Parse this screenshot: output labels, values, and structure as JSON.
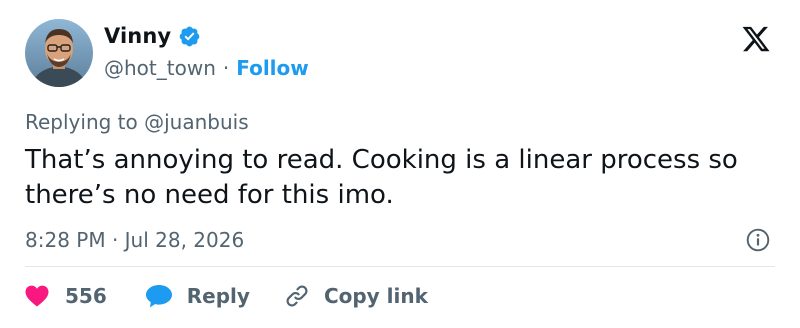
{
  "author": {
    "display_name": "Vinny",
    "handle": "@hot_town",
    "separator": "·",
    "follow_label": "Follow"
  },
  "reply_context": "Replying to @juanbuis",
  "tweet": {
    "text": "That’s annoying to read. Cooking is a linear process so there’s no need for this imo.",
    "timestamp": "8:28 PM · Jul 28, 2026"
  },
  "actions": {
    "like_count": "556",
    "reply_label": "Reply",
    "copy_link_label": "Copy link"
  },
  "icons": {
    "brand": "x-logo-icon",
    "verified": "verified-badge-icon",
    "info": "info-icon",
    "like": "heart-icon",
    "reply": "speech-bubble-icon",
    "copy": "link-icon"
  },
  "colors": {
    "accent": "#1d9bf0",
    "like": "#f91880",
    "text": "#0f1419",
    "muted": "#536471",
    "divider": "#e1e8ed"
  }
}
